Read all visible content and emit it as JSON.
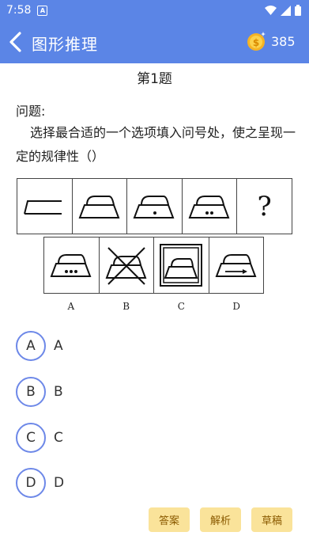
{
  "status_bar": {
    "time": "7:58",
    "notification_glyph": "A"
  },
  "header": {
    "title": "图形推理",
    "coins": "385"
  },
  "question": {
    "number_label": "第1题",
    "label": "问题:",
    "text": "选择最合适的一个选项填入问号处，使之呈现一定的规律性（）",
    "unknown_mark": "?",
    "figure_option_labels": [
      "A",
      "B",
      "C",
      "D"
    ]
  },
  "options": [
    {
      "letter": "A",
      "text": "A"
    },
    {
      "letter": "B",
      "text": "B"
    },
    {
      "letter": "C",
      "text": "C"
    },
    {
      "letter": "D",
      "text": "D"
    }
  ],
  "buttons": {
    "answer": "答案",
    "analysis": "解析",
    "draft": "草稿"
  },
  "colors": {
    "primary": "#5b85e6",
    "option_ring": "#6d88e8",
    "button_bg": "#fae39a"
  }
}
